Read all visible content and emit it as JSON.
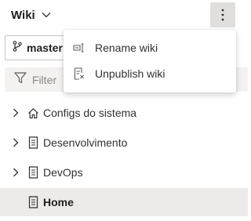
{
  "header": {
    "title": "Wiki",
    "title_icon": "chevron-down-icon",
    "more_icon": "more-vertical-icon"
  },
  "branch": {
    "name": "master",
    "icon": "branch-icon"
  },
  "filter": {
    "placeholder": "Filter",
    "icon": "filter-icon"
  },
  "tree": {
    "items": [
      {
        "label": "Configs do sistema",
        "icon": "home-icon",
        "expandable": true,
        "selected": false
      },
      {
        "label": "Desenvolvimento",
        "icon": "page-icon",
        "expandable": true,
        "selected": false
      },
      {
        "label": "DevOps",
        "icon": "page-icon",
        "expandable": true,
        "selected": false
      },
      {
        "label": "Home",
        "icon": "page-icon",
        "expandable": false,
        "selected": true
      }
    ]
  },
  "menu": {
    "items": [
      {
        "label": "Rename wiki",
        "icon": "rename-icon"
      },
      {
        "label": "Unpublish wiki",
        "icon": "unpublish-icon"
      }
    ]
  },
  "colors": {
    "selected_row_bg": "#edebe9",
    "more_button_bg": "#e1dfdd",
    "filter_bg": "#f3f2f1",
    "text": "#323130"
  }
}
